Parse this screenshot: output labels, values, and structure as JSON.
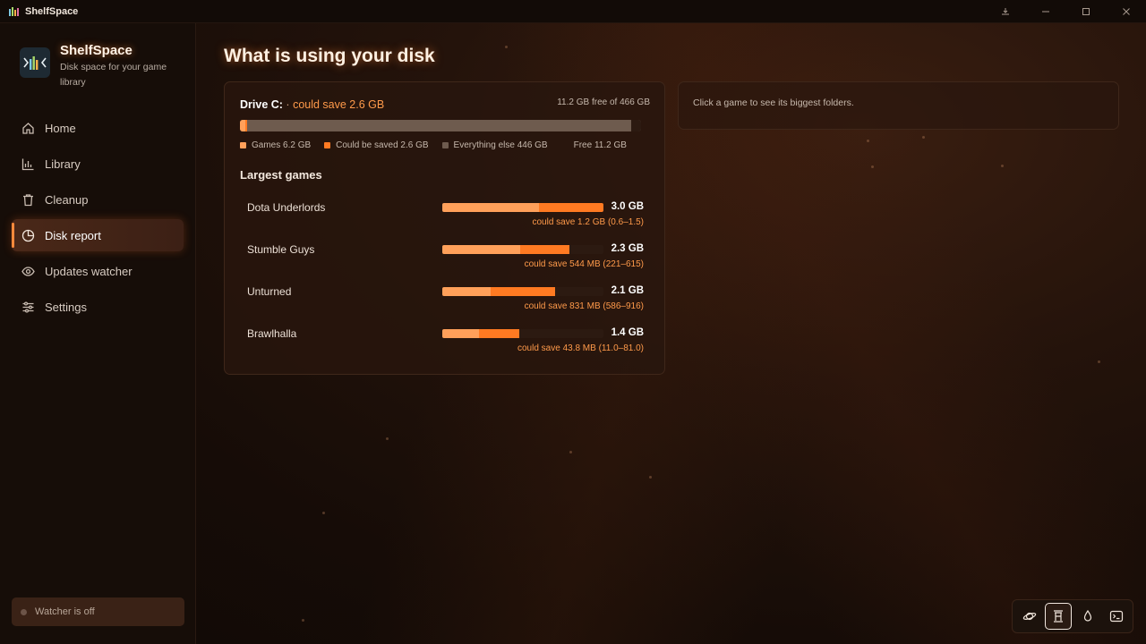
{
  "titlebar": {
    "title": "ShelfSpace",
    "buttons": [
      "download-icon",
      "minimize-icon",
      "maximize-icon",
      "close-icon"
    ]
  },
  "sidebar": {
    "brand_name": "ShelfSpace",
    "brand_subtitle": "Disk space for your game library",
    "items": [
      {
        "label": "Home",
        "icon": "home-icon"
      },
      {
        "label": "Library",
        "icon": "chart-icon"
      },
      {
        "label": "Cleanup",
        "icon": "trash-icon"
      },
      {
        "label": "Disk report",
        "icon": "pie-chart-icon",
        "active": true
      },
      {
        "label": "Updates watcher",
        "icon": "eye-icon"
      },
      {
        "label": "Settings",
        "icon": "sliders-icon"
      }
    ],
    "watcher_status": "Watcher is off"
  },
  "main": {
    "title": "What is using your disk",
    "drive": {
      "name": "Drive C:",
      "separator": "·",
      "could_save": "could save 2.6 GB",
      "free_text": "11.2 GB free of 466 GB",
      "bar_fractions": {
        "games": 0.0133,
        "saveable": 0.0056,
        "other": 0.957,
        "free": 0.024
      },
      "legend": [
        {
          "label": "Games 6.2 GB",
          "color": "#ffa05a"
        },
        {
          "label": "Could be saved 2.6 GB",
          "color": "#ff7a22"
        },
        {
          "label": "Everything else 446 GB",
          "color": "#6e5b4e"
        },
        {
          "label": "Free 11.2 GB",
          "color": "transparent"
        }
      ]
    },
    "largest_title": "Largest games",
    "games": [
      {
        "name": "Dota Underlords",
        "size": "3.0 GB",
        "save": "could save 1.2 GB (0.6–1.5)",
        "fill": 1.0,
        "keep": 0.6
      },
      {
        "name": "Stumble Guys",
        "size": "2.3 GB",
        "save": "could save 544 MB (221–615)",
        "fill": 0.79,
        "keep": 0.61
      },
      {
        "name": "Unturned",
        "size": "2.1 GB",
        "save": "could save 831 MB (586–916)",
        "fill": 0.7,
        "keep": 0.43
      },
      {
        "name": "Brawlhalla",
        "size": "1.4 GB",
        "save": "could save 43.8 MB (11.0–81.0)",
        "fill": 0.48,
        "keep": 0.47
      }
    ],
    "side_hint": "Click a game to see its biggest folders."
  },
  "theme_switcher": {
    "options": [
      "planet-icon",
      "lantern-icon",
      "drop-icon",
      "terminal-icon"
    ],
    "active_index": 1
  },
  "colors": {
    "accent": "#ff8a3c",
    "bar_keep": "#ffa05a",
    "bar_save": "#ff7a22"
  }
}
